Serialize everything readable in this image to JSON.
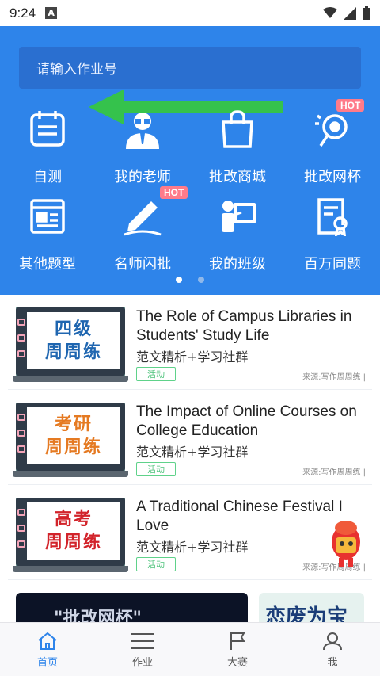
{
  "status_bar": {
    "time": "9:24",
    "notification_letter": "A"
  },
  "search": {
    "placeholder": "请输入作业号"
  },
  "grid": [
    {
      "label": "自测",
      "icon": "clipboard-icon"
    },
    {
      "label": "我的老师",
      "icon": "teacher-icon"
    },
    {
      "label": "批改商城",
      "icon": "shopping-bag-icon"
    },
    {
      "label": "批改网杯",
      "icon": "trophy-icon",
      "badge": "HOT"
    },
    {
      "label": "其他题型",
      "icon": "document-icon"
    },
    {
      "label": "名师闪批",
      "icon": "pen-icon",
      "badge": "HOT"
    },
    {
      "label": "我的班级",
      "icon": "class-board-icon"
    },
    {
      "label": "百万同题",
      "icon": "certificate-icon"
    }
  ],
  "carousel": {
    "pages": 2,
    "active": 1
  },
  "feed": [
    {
      "thumb_text_line1": "四级",
      "thumb_text_line2": "周周练",
      "thumb_color": "#1f66b0",
      "title": "The Role of Campus Libraries in Students' Study Life",
      "subtitle": "范文精析+学习社群",
      "tag": "活动",
      "source": "来源:写作周周练 |"
    },
    {
      "thumb_text_line1": "考研",
      "thumb_text_line2": "周周练",
      "thumb_color": "#e57a22",
      "title": "The Impact of Online Courses on College Education",
      "subtitle": "范文精析+学习社群",
      "tag": "活动",
      "source": "来源:写作周周练 |"
    },
    {
      "thumb_text_line1": "高考",
      "thumb_text_line2": "周周练",
      "thumb_color": "#d2232a",
      "title": "A Traditional Chinese Festival I Love",
      "subtitle": "范文精析+学习社群",
      "tag": "活动",
      "source": "来源:写作周周练 |"
    }
  ],
  "banners": {
    "left_text": "\"批改网杯\"",
    "right_text": "恋废为宝"
  },
  "tabbar": [
    {
      "label": "首页",
      "icon": "home-icon",
      "active": true
    },
    {
      "label": "作业",
      "icon": "menu-icon",
      "active": false
    },
    {
      "label": "大赛",
      "icon": "flag-icon",
      "active": false
    },
    {
      "label": "我",
      "icon": "user-icon",
      "active": false
    }
  ],
  "colors": {
    "primary": "#2e84ea",
    "search_bg": "#2a6fd0",
    "hot": "#ff7b8a",
    "tag_green": "#4cc27a",
    "arrow_green": "#35c24c",
    "tab_active": "#2e84ea",
    "tab_inactive": "#555555"
  }
}
